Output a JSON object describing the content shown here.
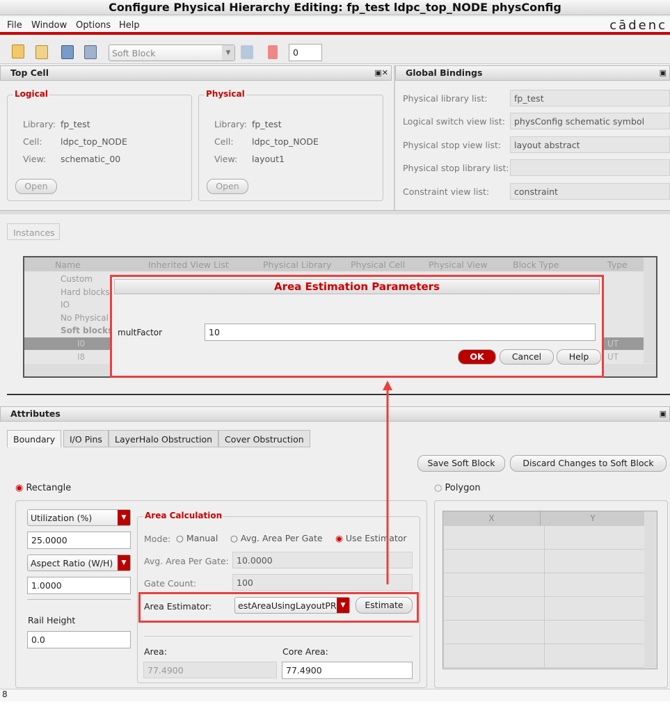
{
  "window": {
    "title": "Configure Physical Hierarchy Editing: fp_test ldpc_top_NODE physConfig"
  },
  "menu": [
    "File",
    "Window",
    "Options",
    "Help"
  ],
  "brand": "cādenc",
  "toolbar": {
    "block_type": "Soft Block",
    "counter": "0"
  },
  "top_cell": {
    "title": "Top Cell",
    "logical": {
      "title": "Logical",
      "library_label": "Library:",
      "library": "fp_test",
      "cell_label": "Cell:",
      "cell": "ldpc_top_NODE",
      "view_label": "View:",
      "view": "schematic_00",
      "open": "Open"
    },
    "physical": {
      "title": "Physical",
      "library_label": "Library:",
      "library": "fp_test",
      "cell_label": "Cell:",
      "cell": "ldpc_top_NODE",
      "view_label": "View:",
      "view": "layout1",
      "open": "Open"
    }
  },
  "global_bindings": {
    "title": "Global Bindings",
    "rows": [
      {
        "label": "Physical library list:",
        "value": "fp_test"
      },
      {
        "label": "Logical switch view list:",
        "value": "physConfig schematic symbol"
      },
      {
        "label": "Physical stop view list:",
        "value": "layout abstract"
      },
      {
        "label": "Physical stop library list:",
        "value": ""
      },
      {
        "label": "Constraint view list:",
        "value": "constraint"
      }
    ]
  },
  "instances": {
    "tab": "Instances",
    "columns": [
      "Name",
      "Inherited View List",
      "Physical Library",
      "Physical Cell",
      "Physical View",
      "Block Type",
      "Type"
    ],
    "tree": [
      "Custom",
      "Hard blocks",
      "IO",
      "No Physical",
      "Soft blocks",
      "I0",
      "I8"
    ],
    "type_col": [
      "UT",
      "UT"
    ]
  },
  "dialog": {
    "title": "Area Estimation Parameters",
    "param_label": "multFactor",
    "param_value": "10",
    "ok": "OK",
    "cancel": "Cancel",
    "help": "Help"
  },
  "attributes": {
    "title": "Attributes",
    "tabs": [
      "Boundary",
      "I/O Pins",
      "LayerHalo Obstruction",
      "Cover Obstruction"
    ],
    "save": "Save Soft Block",
    "discard": "Discard Changes to Soft Block",
    "rectangle": "Rectangle",
    "polygon": "Polygon",
    "util_select": "Utilization (%)",
    "util_value": "25.0000",
    "aspect_select": "Aspect Ratio (W/H)",
    "aspect_value": "1.0000",
    "rail_label": "Rail Height",
    "rail_value": "0.0",
    "area_calc": {
      "title": "Area Calculation",
      "mode_label": "Mode:",
      "modes": [
        "Manual",
        "Avg. Area Per Gate",
        "Use Estimator"
      ],
      "avg_label": "Avg. Area Per Gate:",
      "avg_value": "10.0000",
      "gate_label": "Gate Count:",
      "gate_value": "100",
      "estimator_label": "Area Estimator:",
      "estimator_value": "estAreaUsingLayoutPR",
      "estimate": "Estimate",
      "area_label": "Area:",
      "area_value": "77.4900",
      "core_label": "Core Area:",
      "core_value": "77.4900"
    },
    "poly_columns": [
      "X",
      "Y"
    ]
  },
  "status": "8"
}
